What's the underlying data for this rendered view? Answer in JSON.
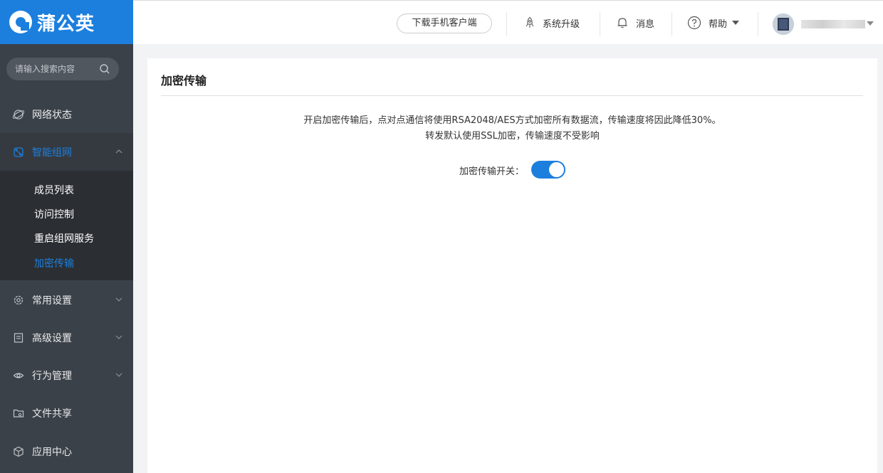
{
  "brand": {
    "name": "蒲公英"
  },
  "sidebar": {
    "search_placeholder": "请输入搜索内容",
    "items": [
      {
        "label": "网络状态",
        "icon": "globe-icon"
      },
      {
        "label": "智能组网",
        "icon": "network-icon",
        "expanded": true
      },
      {
        "label": "常用设置",
        "icon": "gear-icon"
      },
      {
        "label": "高级设置",
        "icon": "document-icon"
      },
      {
        "label": "行为管理",
        "icon": "eye-icon"
      },
      {
        "label": "文件共享",
        "icon": "folder-icon"
      },
      {
        "label": "应用中心",
        "icon": "cube-icon"
      }
    ],
    "sub_items": [
      {
        "label": "成员列表"
      },
      {
        "label": "访问控制"
      },
      {
        "label": "重启组网服务"
      },
      {
        "label": "加密传输",
        "active": true
      }
    ]
  },
  "header": {
    "download_label": "下载手机客户端",
    "upgrade_label": "系统升级",
    "message_label": "消息",
    "help_label": "帮助"
  },
  "main": {
    "title": "加密传输",
    "description_line1": "开启加密传输后，点对点通信将使用RSA2048/AES方式加密所有数据流，传输速度将因此降低30%。",
    "description_line2": "转发默认使用SSL加密，传输速度不受影响",
    "switch_label": "加密传输开关：",
    "switch_on": true
  },
  "colors": {
    "accent": "#1c7fde",
    "sidebar_bg": "#3b4148",
    "submenu_bg": "#2b2f34"
  }
}
